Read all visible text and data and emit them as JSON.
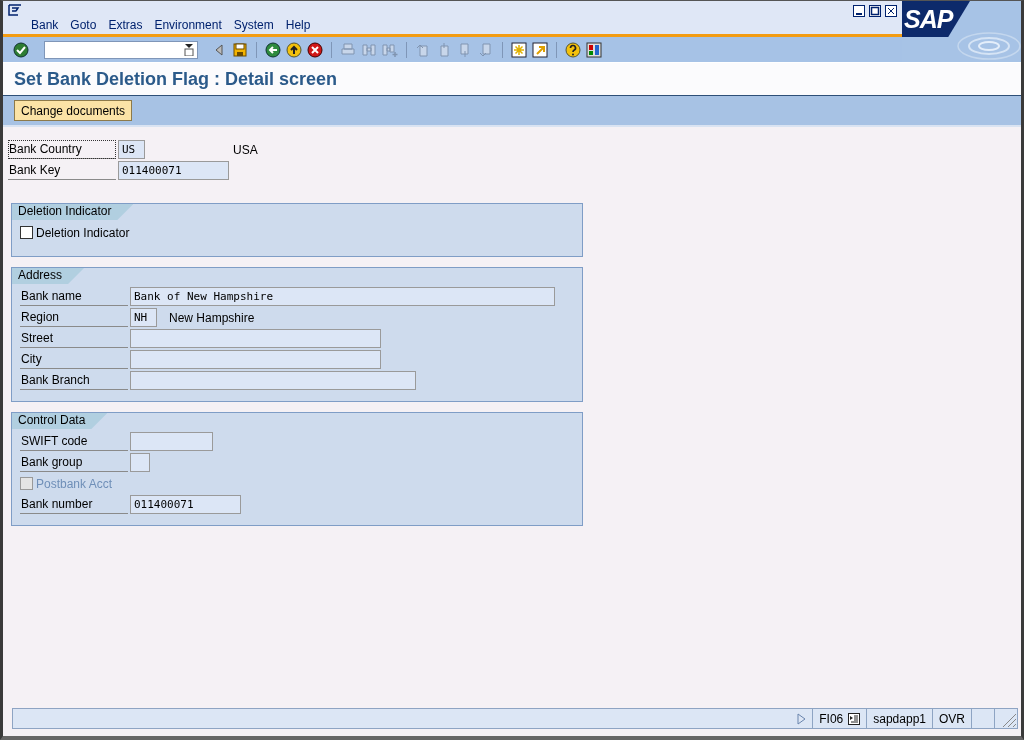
{
  "window": {
    "logo": "SAP"
  },
  "menu": [
    {
      "label": "Bank"
    },
    {
      "label": "Goto"
    },
    {
      "label": "Extras"
    },
    {
      "label": "Environment"
    },
    {
      "label": "System"
    },
    {
      "label": "Help"
    }
  ],
  "title": "Set Bank Deletion Flag : Detail screen",
  "app_toolbar": [
    {
      "label": "Change documents"
    }
  ],
  "header_fields": [
    {
      "label": "Bank Country",
      "value": "US",
      "description": "USA",
      "focused": true
    },
    {
      "label": "Bank Key",
      "value": "011400071",
      "focused": false
    }
  ],
  "groups": [
    {
      "title": "Deletion Indicator",
      "rows": [
        {
          "kind": "checkbox",
          "label": "Deletion Indicator",
          "checked": false,
          "disabled": false
        }
      ]
    },
    {
      "title": "Address",
      "rows": [
        {
          "kind": "field",
          "label": "Bank name",
          "value": "Bank of New Hampshire"
        },
        {
          "kind": "field",
          "label": "Region",
          "value": "NH",
          "description": "New Hampshire"
        },
        {
          "kind": "field",
          "label": "Street"
        },
        {
          "kind": "field",
          "label": "City"
        },
        {
          "kind": "field",
          "label": "Bank Branch"
        }
      ]
    },
    {
      "title": "Control Data",
      "rows": [
        {
          "kind": "field",
          "label": "SWIFT code"
        },
        {
          "kind": "field",
          "label": "Bank group"
        },
        {
          "kind": "checkbox",
          "label": "Postbank Acct",
          "checked": false,
          "disabled": true
        },
        {
          "kind": "field",
          "label": "Bank number",
          "value": "011400071"
        }
      ]
    }
  ],
  "status_bar": {
    "transaction": "FI06",
    "server": "sapdapp1",
    "mode": "OVR"
  }
}
